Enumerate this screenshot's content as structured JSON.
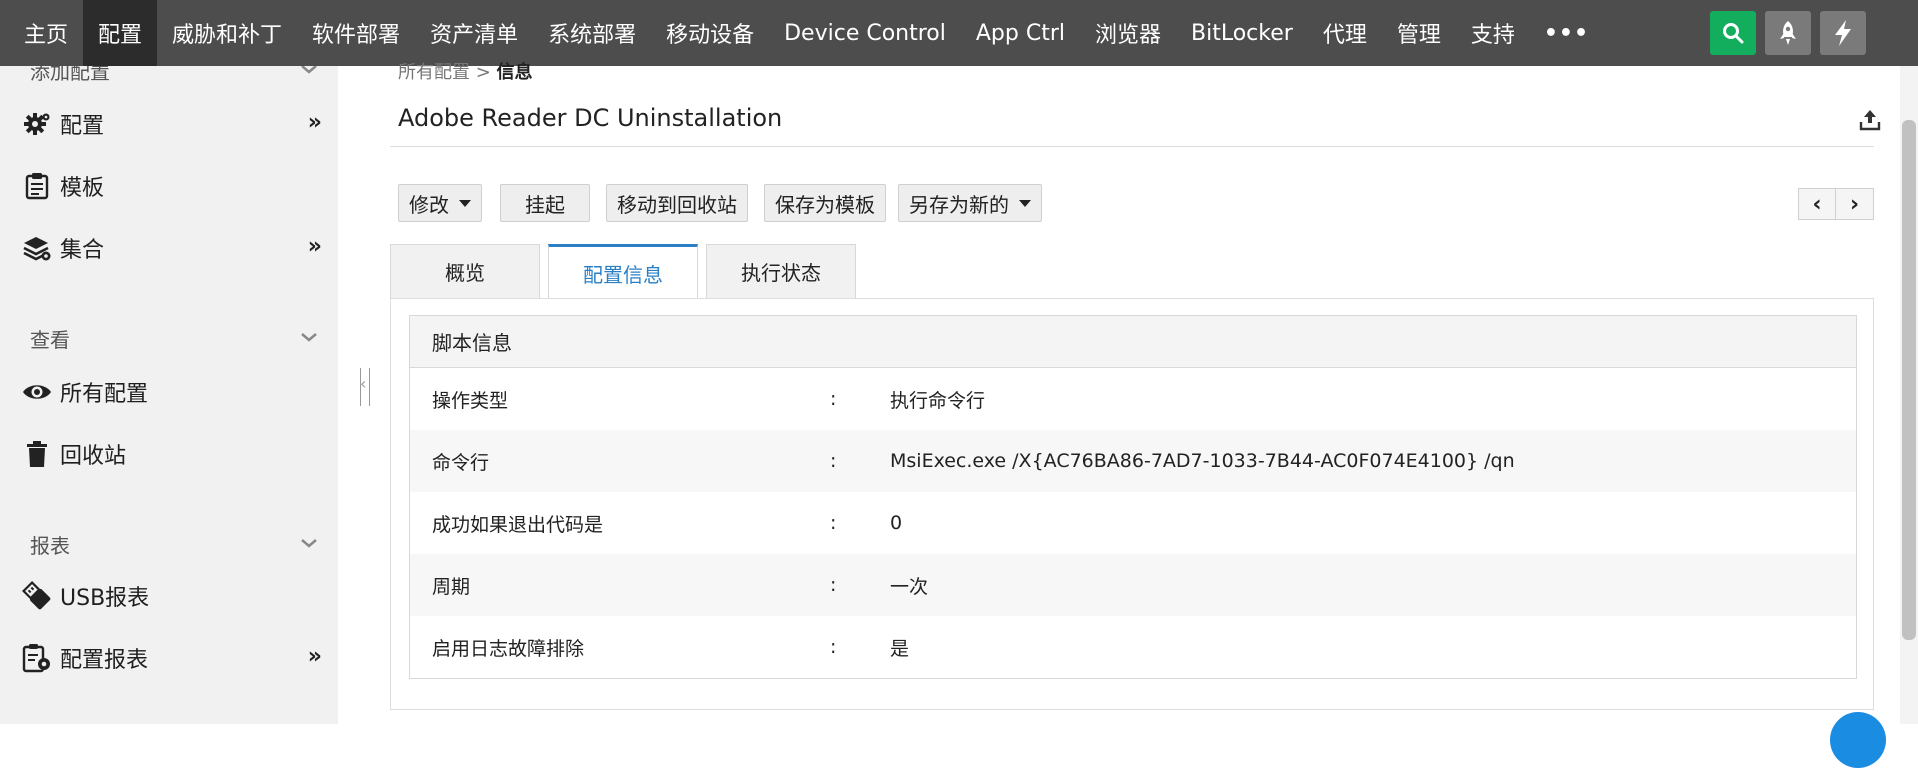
{
  "topnav": {
    "items": [
      "主页",
      "配置",
      "威胁和补丁",
      "软件部署",
      "资产清单",
      "系统部署",
      "移动设备",
      "Device Control",
      "App Ctrl",
      "浏览器",
      "BitLocker",
      "代理",
      "管理",
      "支持"
    ],
    "more": "•••",
    "active_index": 1
  },
  "sidebar": {
    "partial_title": "添加配置",
    "items_add": [
      {
        "label": "配置",
        "icon": "gear-icon",
        "has_submenu": true
      },
      {
        "label": "模板",
        "icon": "clipboard-icon",
        "has_submenu": false
      },
      {
        "label": "集合",
        "icon": "layers-icon",
        "has_submenu": true
      }
    ],
    "section_view": "查看",
    "items_view": [
      {
        "label": "所有配置",
        "icon": "eye-icon"
      },
      {
        "label": "回收站",
        "icon": "trash-icon"
      }
    ],
    "section_reports": "报表",
    "items_reports": [
      {
        "label": "USB报表",
        "icon": "usb-icon",
        "has_submenu": false
      },
      {
        "label": "配置报表",
        "icon": "report-icon",
        "has_submenu": true
      }
    ],
    "submenu_arrow": "»"
  },
  "breadcrumb": {
    "parent": "所有配置",
    "separator": " > ",
    "current": "信息"
  },
  "page_title": "Adobe Reader DC Uninstallation",
  "toolbar": {
    "modify": "修改",
    "suspend": "挂起",
    "move_to_trash": "移动到回收站",
    "save_as_template": "保存为模板",
    "save_as_new": "另存为新的"
  },
  "pager": {
    "prev": "‹",
    "next": "›"
  },
  "tabs": [
    "概览",
    "配置信息",
    "执行状态"
  ],
  "active_tab": 1,
  "script_info": {
    "title": "脚本信息",
    "separator": ":",
    "rows": [
      {
        "key": "操作类型",
        "value": "执行命令行"
      },
      {
        "key": "命令行",
        "value": "MsiExec.exe /X{AC76BA86-7AD7-1033-7B44-AC0F074E4100} /qn"
      },
      {
        "key": "成功如果退出代码是",
        "value": "0"
      },
      {
        "key": "周期",
        "value": "一次"
      },
      {
        "key": "启用日志故障排除",
        "value": "是"
      }
    ]
  },
  "colors": {
    "nav_bg": "#4d4d4d",
    "accent_blue": "#2b80c5",
    "search_green": "#13ad5e"
  }
}
